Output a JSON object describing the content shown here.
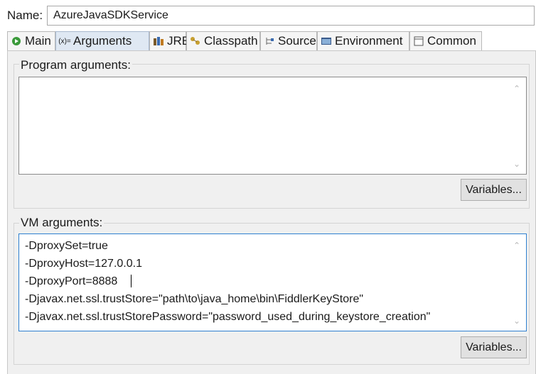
{
  "name": {
    "label": "Name:",
    "value": "AzureJavaSDKService"
  },
  "tabs": [
    {
      "label": "Main",
      "icon": "run-config-icon"
    },
    {
      "label": "Arguments",
      "icon": "arguments-icon"
    },
    {
      "label": "JRE",
      "icon": "library-icon"
    },
    {
      "label": "Classpath",
      "icon": "classpath-icon"
    },
    {
      "label": "Source",
      "icon": "source-icon"
    },
    {
      "label": "Environment",
      "icon": "environment-icon"
    },
    {
      "label": "Common",
      "icon": "common-icon"
    }
  ],
  "program_args": {
    "label": "Program arguments:",
    "value": "",
    "variables_button": "Variables..."
  },
  "vm_args": {
    "label": "VM arguments:",
    "lines": [
      "-DproxySet=true",
      "-DproxyHost=127.0.0.1",
      "-DproxyPort=8888",
      "-Djavax.net.ssl.trustStore=\"path\\to\\java_home\\bin\\FiddlerKeyStore\"",
      "-Djavax.net.ssl.trustStorePassword=\"password_used_during_keystore_creation\""
    ],
    "variables_button": "Variables..."
  },
  "colors": {
    "active_tab": "#dfe8f3",
    "focus_border": "#2d7fd0",
    "panel_bg": "#f0f0f0"
  }
}
